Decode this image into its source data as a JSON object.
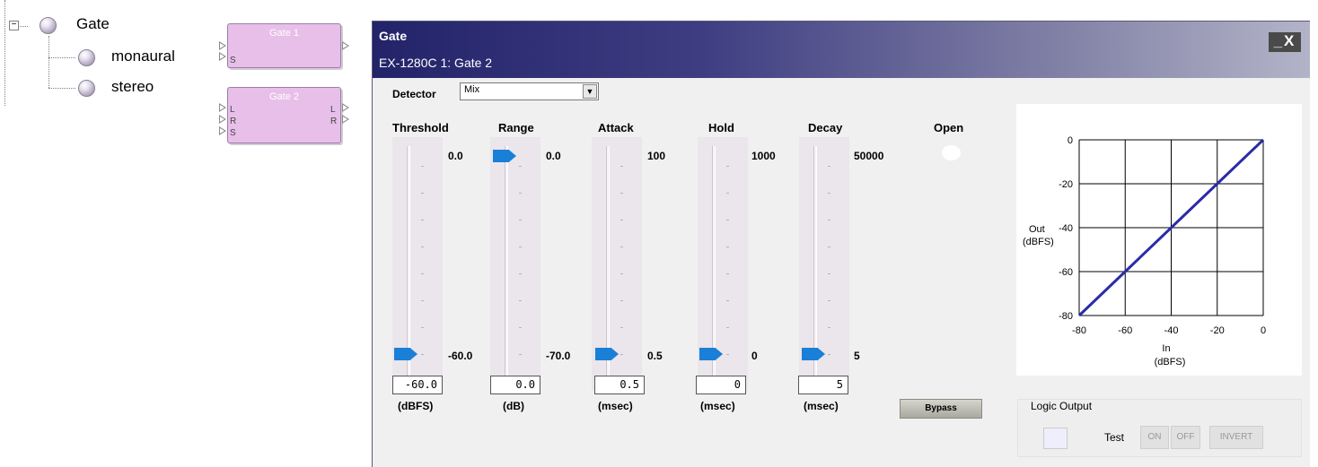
{
  "tree": {
    "root_label": "Gate",
    "items": [
      {
        "label": "monaural"
      },
      {
        "label": "stereo"
      }
    ]
  },
  "blocks": [
    {
      "title": "Gate 1",
      "inputs": [
        "S"
      ],
      "outputs": []
    },
    {
      "title": "Gate 2",
      "inputs": [
        "L",
        "R",
        "S"
      ],
      "outputs": [
        "L",
        "R"
      ]
    }
  ],
  "window": {
    "title": "Gate",
    "subtitle": "EX-1280C 1: Gate 2",
    "controls_glyph": "_X",
    "detector": {
      "label": "Detector",
      "value": "Mix"
    },
    "sliders": [
      {
        "name": "Threshold",
        "max_label": "0.0",
        "min_label": "-60.0",
        "value": "-60.0",
        "unit": "(dBFS)",
        "position": 0
      },
      {
        "name": "Range",
        "max_label": "0.0",
        "min_label": "-70.0",
        "value": "0.0",
        "unit": "(dB)",
        "position": 1
      },
      {
        "name": "Attack",
        "max_label": "100",
        "min_label": "0.5",
        "value": "0.5",
        "unit": "(msec)",
        "position": 0
      },
      {
        "name": "Hold",
        "max_label": "1000",
        "min_label": "0",
        "value": "0",
        "unit": "(msec)",
        "position": 0
      },
      {
        "name": "Decay",
        "max_label": "50000",
        "min_label": "5",
        "value": "5",
        "unit": "(msec)",
        "position": 0
      }
    ],
    "open_label": "Open",
    "bypass_label": "Bypass",
    "logic_output": {
      "title": "Logic Output",
      "test_label": "Test",
      "on_label": "ON",
      "off_label": "OFF",
      "invert_label": "INVERT"
    },
    "graph": {
      "ylabel_line1": "Out",
      "ylabel_line2": "(dBFS)",
      "xlabel_line1": "In",
      "xlabel_line2": "(dBFS)",
      "y_ticks": [
        "0",
        "-20",
        "-40",
        "-60",
        "-80"
      ],
      "x_ticks": [
        "-80",
        "-60",
        "-40",
        "-20",
        "0"
      ]
    }
  },
  "chart_data": {
    "type": "line",
    "title": "",
    "xlabel": "In (dBFS)",
    "ylabel": "Out (dBFS)",
    "xlim": [
      -80,
      0
    ],
    "ylim": [
      -80,
      0
    ],
    "grid": true,
    "series": [
      {
        "x": [
          -80,
          -60,
          -40,
          -20,
          0
        ],
        "y": [
          -80,
          -60,
          -40,
          -20,
          0
        ],
        "color": "#2b2ba8"
      }
    ]
  }
}
